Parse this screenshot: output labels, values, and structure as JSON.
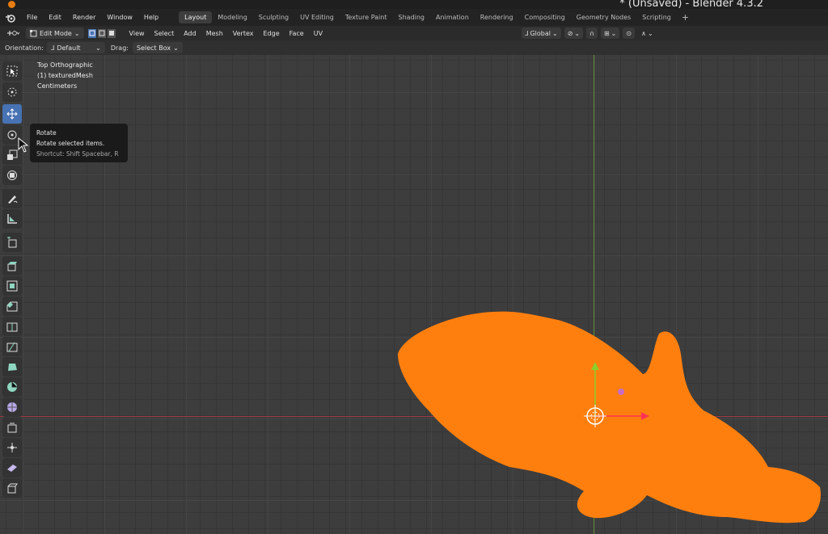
{
  "window": {
    "title": "* (Unsaved) - Blender 4.3.2"
  },
  "menu": [
    "File",
    "Edit",
    "Render",
    "Window",
    "Help"
  ],
  "workspaces": [
    "Layout",
    "Modeling",
    "Sculpting",
    "UV Editing",
    "Texture Paint",
    "Shading",
    "Animation",
    "Rendering",
    "Compositing",
    "Geometry Nodes",
    "Scripting"
  ],
  "active_workspace": "Layout",
  "header": {
    "mode": "Edit Mode",
    "menus": [
      "View",
      "Select",
      "Add",
      "Mesh",
      "Vertex",
      "Edge",
      "Face",
      "UV"
    ],
    "transform_orientation": "Global"
  },
  "orientation_bar": {
    "orientation_label": "Orientation:",
    "orientation_value": "Default",
    "drag_label": "Drag:",
    "drag_value": "Select Box"
  },
  "viewport_info": {
    "view": "Top Orthographic",
    "object": "(1) texturedMesh",
    "units": "Centimeters"
  },
  "tooltip": {
    "title": "Rotate",
    "description": "Rotate selected items.",
    "shortcut": "Shortcut: Shift Spacebar, R"
  },
  "colors": {
    "accent": "#4772b3",
    "mesh": "#ff7f0e",
    "axis_x": "#a13a44",
    "axis_y": "#5e8a2a"
  },
  "tools": [
    "select-box-icon",
    "cursor-icon",
    "move-icon",
    "rotate-icon",
    "scale-icon",
    "transform-icon",
    "annotate-icon",
    "measure-icon",
    "add-cube-icon",
    "extrude-icon",
    "inset-icon",
    "bevel-icon",
    "loop-cut-icon",
    "knife-icon",
    "poly-build-icon",
    "spin-icon",
    "smooth-icon",
    "edge-slide-icon",
    "shrink-fatten-icon",
    "shear-icon",
    "rip-icon"
  ]
}
